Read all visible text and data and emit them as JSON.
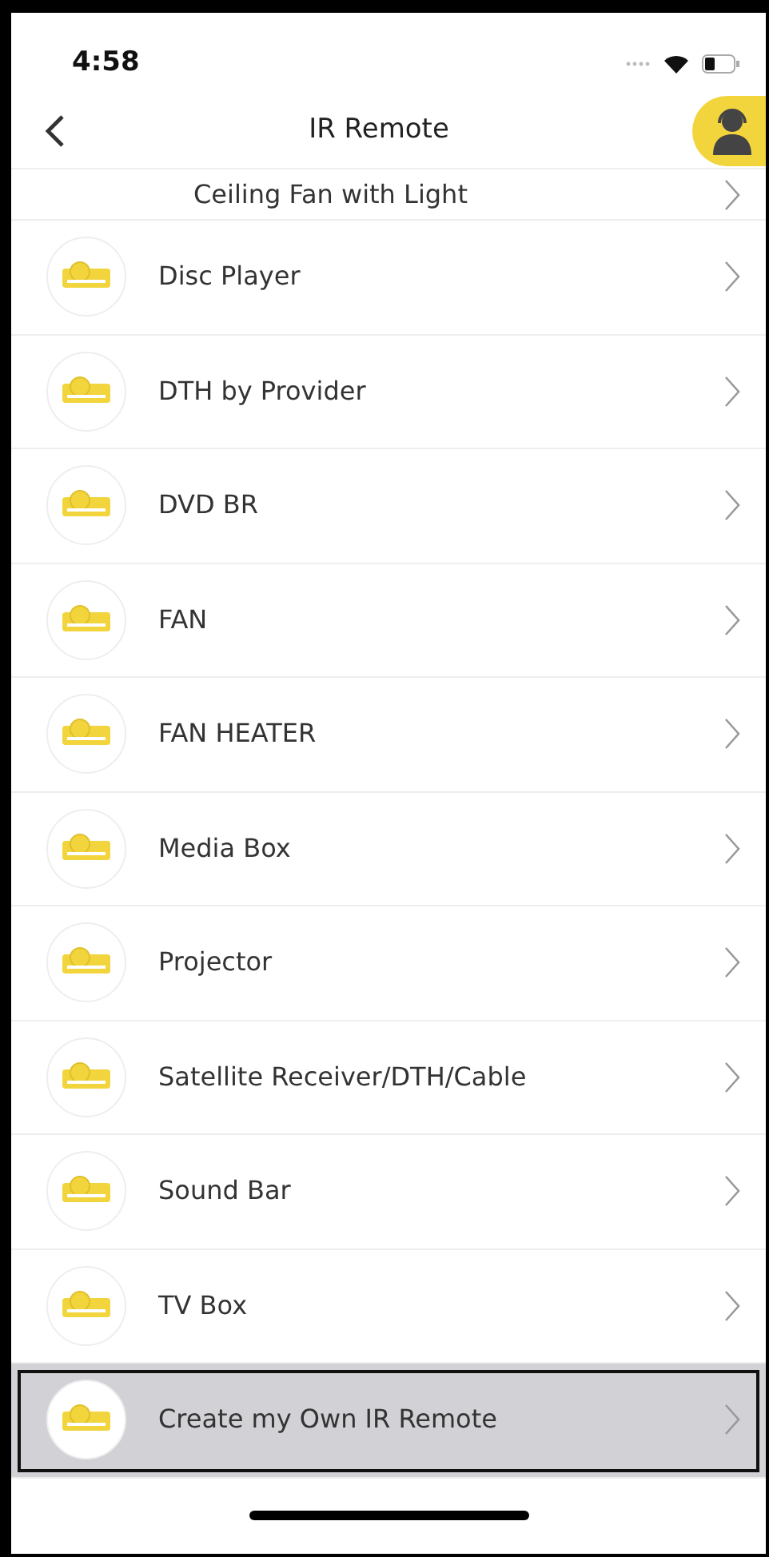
{
  "status_bar": {
    "time": "4:58"
  },
  "header": {
    "title": "IR Remote"
  },
  "items": [
    {
      "label": "Ceiling Fan with Light",
      "selected": false
    },
    {
      "label": "Disc Player",
      "selected": false
    },
    {
      "label": "DTH by Provider",
      "selected": false
    },
    {
      "label": "DVD BR",
      "selected": false
    },
    {
      "label": "FAN",
      "selected": false
    },
    {
      "label": "FAN HEATER",
      "selected": false
    },
    {
      "label": "Media Box",
      "selected": false
    },
    {
      "label": "Projector",
      "selected": false
    },
    {
      "label": "Satellite Receiver/DTH/Cable",
      "selected": false
    },
    {
      "label": "Sound Bar",
      "selected": false
    },
    {
      "label": "TV Box",
      "selected": false
    },
    {
      "label": "Create my Own IR Remote",
      "selected": true
    }
  ]
}
